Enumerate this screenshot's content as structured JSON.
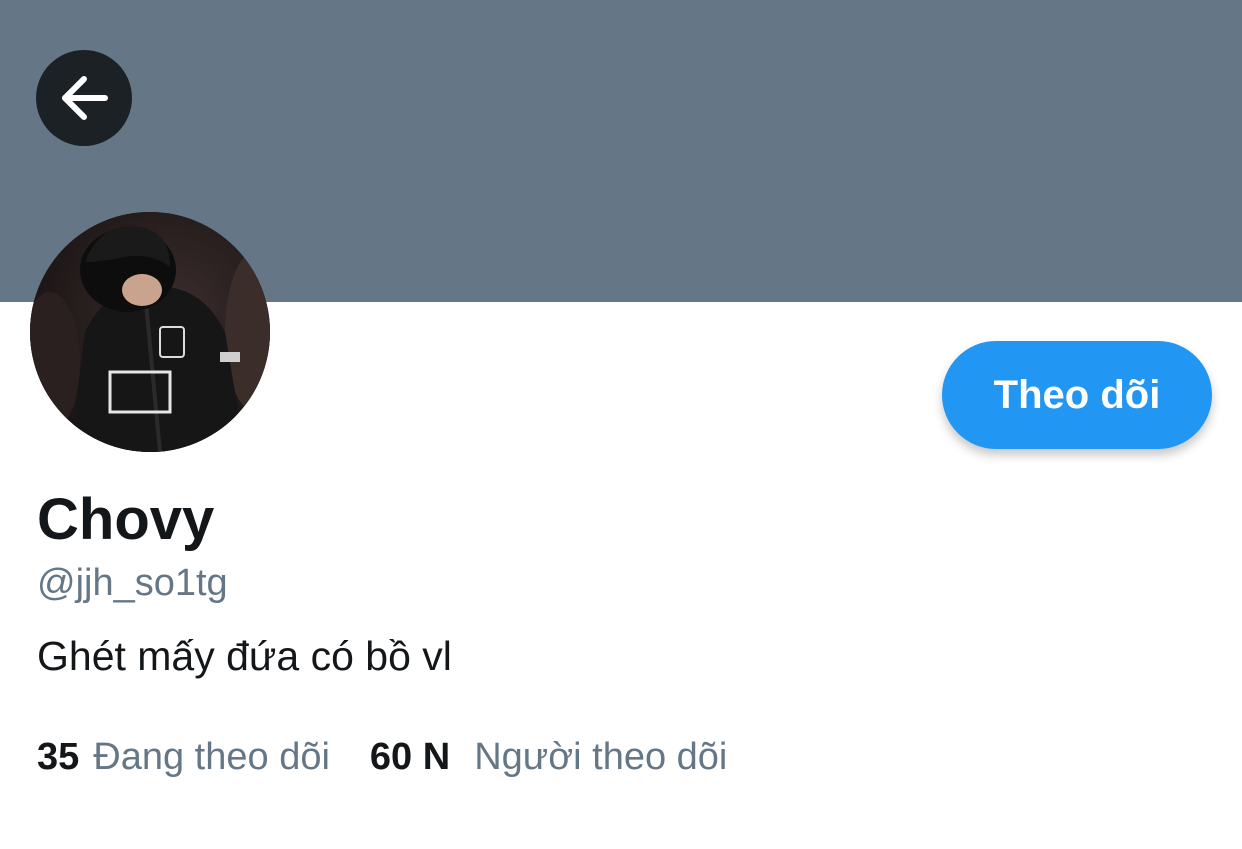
{
  "header": {
    "back_icon": "arrow-left-icon",
    "banner_color": "#657786"
  },
  "profile": {
    "display_name": "Chovy",
    "handle": "@jjh_so1tg",
    "bio": "Ghét mấy đứa có bồ vl",
    "follow_label": "Theo dõi",
    "accent_color": "#2196f3"
  },
  "stats": {
    "following_count": "35",
    "following_label": "Đang theo dõi",
    "followers_count": "60 N",
    "followers_label": "Người theo dõi"
  }
}
